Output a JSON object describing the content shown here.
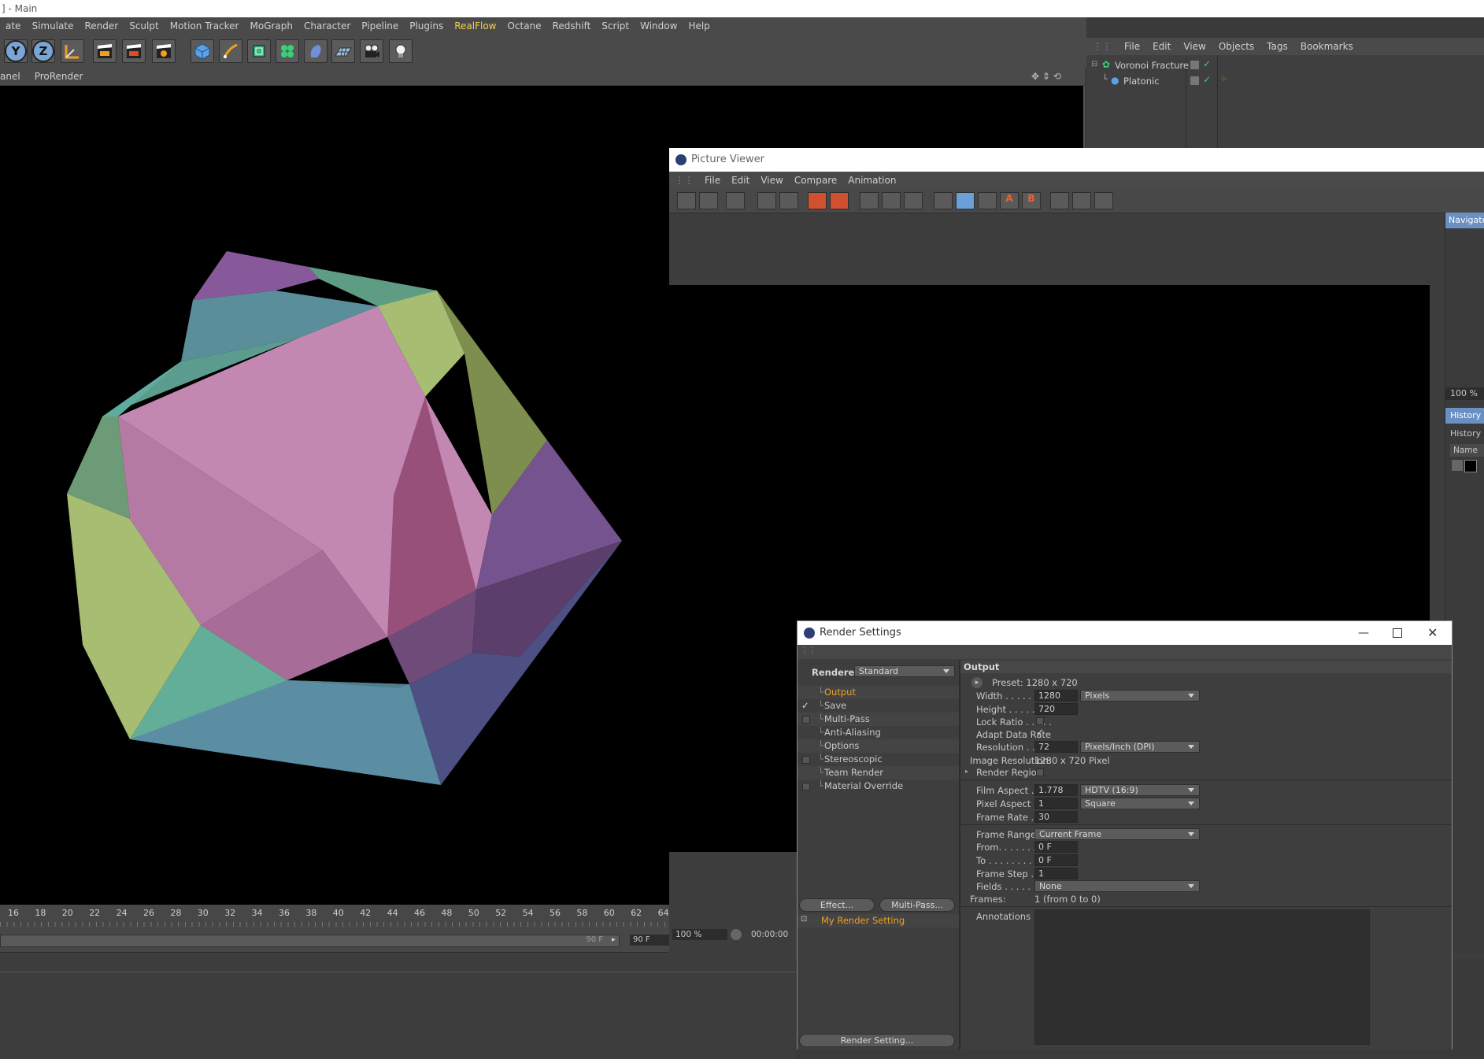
{
  "app": {
    "title": "] - Main"
  },
  "menu": [
    "ate",
    "Simulate",
    "Render",
    "Sculpt",
    "Motion Tracker",
    "MoGraph",
    "Character",
    "Pipeline",
    "Plugins",
    "RealFlow",
    "Octane",
    "Redshift",
    "Script",
    "Window",
    "Help"
  ],
  "menu_highlight": "RealFlow",
  "toolbar": {
    "axis_y": "Y",
    "axis_z": "Z"
  },
  "viewport_menu": [
    "anel",
    "ProRender"
  ],
  "timeline": {
    "ticks": [
      "16",
      "18",
      "20",
      "22",
      "24",
      "26",
      "28",
      "30",
      "32",
      "34",
      "36",
      "38",
      "40",
      "42",
      "44",
      "46",
      "48",
      "50",
      "52",
      "54",
      "56",
      "58",
      "60",
      "62",
      "64"
    ],
    "end_frame": "90 F",
    "end_field": "90 F"
  },
  "objects_panel": {
    "menu": [
      "File",
      "Edit",
      "View",
      "Objects",
      "Tags",
      "Bookmarks"
    ],
    "items": [
      {
        "name": "Voronoi Fracture"
      },
      {
        "name": "Platonic"
      }
    ]
  },
  "picture_viewer": {
    "title": "Picture Viewer",
    "menu": [
      "File",
      "Edit",
      "View",
      "Compare",
      "Animation"
    ],
    "side": {
      "navigator_tab": "Navigato",
      "zoom": "100 %",
      "history_tab": "History",
      "history_label": "History",
      "name_col": "Name"
    },
    "zoom_field": "100 %",
    "time": "00:00:00"
  },
  "render_settings": {
    "title": "Render Settings",
    "renderer_label": "Renderer",
    "renderer_value": "Standard",
    "items": [
      {
        "label": "Output",
        "active": true,
        "check": ""
      },
      {
        "label": "Save",
        "check": "✓"
      },
      {
        "label": "Multi-Pass",
        "check": "box"
      },
      {
        "label": "Anti-Aliasing",
        "check": ""
      },
      {
        "label": "Options",
        "check": ""
      },
      {
        "label": "Stereoscopic",
        "check": "box"
      },
      {
        "label": "Team Render",
        "check": ""
      },
      {
        "label": "Material Override",
        "check": "box"
      }
    ],
    "effect_button": "Effect...",
    "multipass_button": "Multi-Pass...",
    "my_render_setting": "My Render Setting",
    "render_setting_button": "Render Setting...",
    "output": {
      "header": "Output",
      "preset": "Preset: 1280 x 720",
      "width_label": "Width . . . . . . . . .",
      "width": "1280",
      "width_unit": "Pixels",
      "height_label": "Height . . . . . . . .",
      "height": "720",
      "lock_ratio_label": "Lock Ratio . . . . .",
      "adapt_label": "Adapt Data Rate",
      "resolution_label": "Resolution . . . . .",
      "resolution": "72",
      "resolution_unit": "Pixels/Inch (DPI)",
      "image_resolution_label": "Image Resolution:",
      "image_resolution": "1280 x 720 Pixel",
      "render_region_label": "Render Region",
      "film_aspect_label": "Film Aspect . . . .",
      "film_aspect": "1.778",
      "film_aspect_preset": "HDTV (16:9)",
      "pixel_aspect_label": "Pixel Aspect . . . .",
      "pixel_aspect": "1",
      "pixel_aspect_preset": "Square",
      "frame_rate_label": "Frame Rate . . . .",
      "frame_rate": "30",
      "frame_range_label": "Frame Range . . .",
      "frame_range": "Current Frame",
      "from_label": "From. . . . . . . . . .",
      "from": "0 F",
      "to_label": "To . . . . . . . . . . . .",
      "to": "0 F",
      "frame_step_label": "Frame Step . . . .",
      "frame_step": "1",
      "fields_label": "Fields . . . . . . . . .",
      "fields": "None",
      "frames_label": "Frames:",
      "frames": "1 (from 0 to 0)",
      "annotations_label": "Annotations . . . ."
    }
  },
  "colors": {
    "accent": "#f0a020",
    "ui_bg": "#3a3a3a",
    "pink_face": "#c387b1",
    "green_face": "#9db66e",
    "teal_face": "#5fae97",
    "purple_face": "#74538f",
    "blue_face": "#5184a3"
  }
}
